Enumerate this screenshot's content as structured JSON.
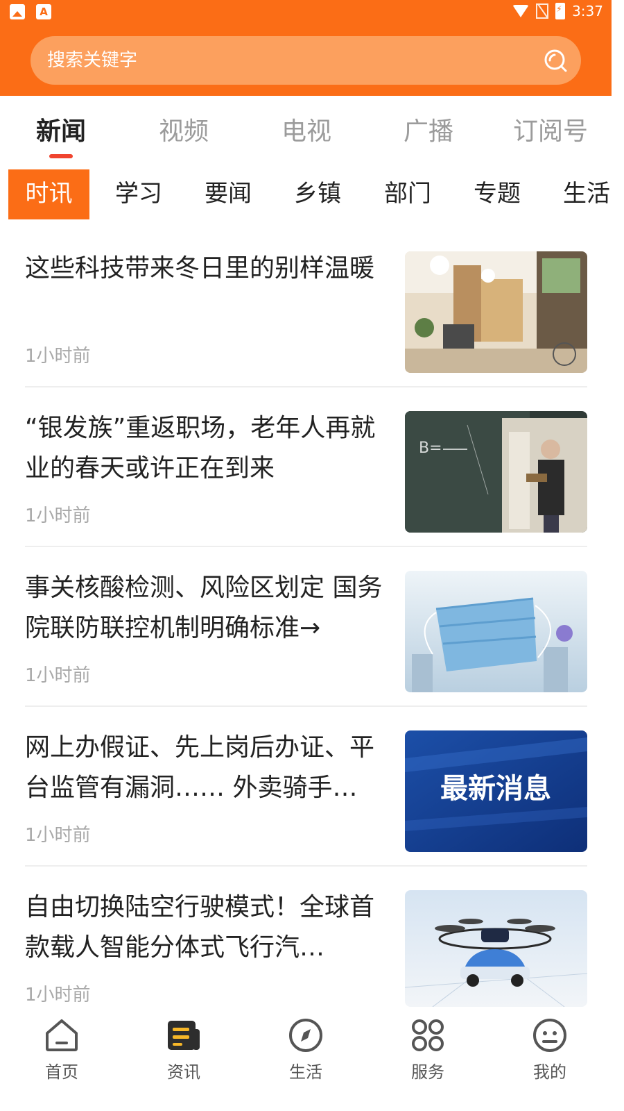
{
  "status_bar": {
    "time": "3:37",
    "left_icons": [
      "image-icon",
      "font-icon"
    ],
    "right_icons": [
      "wifi-icon",
      "no-sim-icon",
      "battery-charging-icon"
    ]
  },
  "search": {
    "placeholder": "搜索关键字",
    "icon": "search-icon"
  },
  "channel_tabs": [
    {
      "label": "新闻",
      "active": true
    },
    {
      "label": "视频",
      "active": false
    },
    {
      "label": "电视",
      "active": false
    },
    {
      "label": "广播",
      "active": false
    },
    {
      "label": "订阅号",
      "active": false
    }
  ],
  "sub_tabs": [
    {
      "label": "时讯",
      "active": true
    },
    {
      "label": "学习",
      "active": false
    },
    {
      "label": "要闻",
      "active": false
    },
    {
      "label": "乡镇",
      "active": false
    },
    {
      "label": "部门",
      "active": false
    },
    {
      "label": "专题",
      "active": false
    },
    {
      "label": "生活",
      "active": false
    }
  ],
  "news": [
    {
      "title": "这些科技带来冬日里的别样温暖",
      "time": "1小时前",
      "thumb": "warm-room-image"
    },
    {
      "title": "“银发族”重返职场，老年人再就业的春天或许正在到来",
      "time": "1小时前",
      "thumb": "teacher-blackboard-image"
    },
    {
      "title": "事关核酸检测、风险区划定 国务院联防联控机制明确标准→",
      "time": "1小时前",
      "thumb": "face-mask-image"
    },
    {
      "title": "网上办假证、先上岗后办证、平台监管有漏洞…… 外卖骑手…",
      "time": "1小时前",
      "thumb": "breaking-news-banner",
      "thumb_text": "最新消息"
    },
    {
      "title": "自由切换陆空行驶模式！全球首款载人智能分体式飞行汽…",
      "time": "1小时前",
      "thumb": "flying-car-image"
    }
  ],
  "bottom_nav": [
    {
      "label": "首页",
      "icon": "home-icon",
      "active": false
    },
    {
      "label": "资讯",
      "icon": "news-icon",
      "active": true
    },
    {
      "label": "生活",
      "icon": "compass-icon",
      "active": false
    },
    {
      "label": "服务",
      "icon": "grid-services-icon",
      "active": false
    },
    {
      "label": "我的",
      "icon": "profile-face-icon",
      "active": false
    }
  ],
  "colors": {
    "brand_orange": "#fb6d16",
    "search_bg": "#fca05e",
    "tab_indicator": "#f0442f",
    "text_primary": "#222222",
    "text_muted": "#a8a8a8"
  }
}
